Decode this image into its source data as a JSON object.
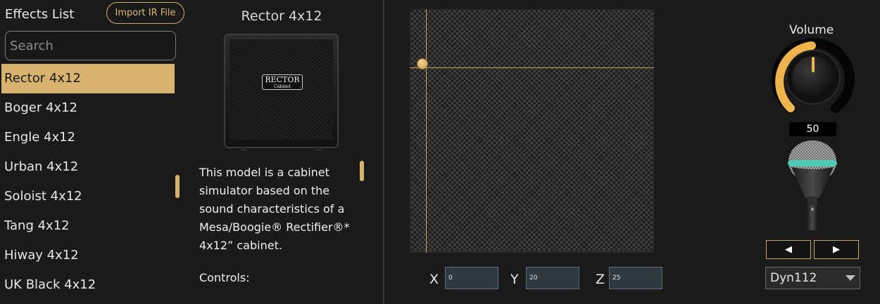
{
  "effects": {
    "title": "Effects List",
    "import_button": "Import IR File",
    "search_placeholder": "Search",
    "items": [
      {
        "label": "Rector 4x12",
        "selected": true
      },
      {
        "label": "Boger 4x12",
        "selected": false
      },
      {
        "label": "Engle 4x12",
        "selected": false
      },
      {
        "label": "Urban 4x12",
        "selected": false
      },
      {
        "label": "Soloist 4x12",
        "selected": false
      },
      {
        "label": "Tang 4x12",
        "selected": false
      },
      {
        "label": "Hiway 4x12",
        "selected": false
      },
      {
        "label": "UK Black 4x12",
        "selected": false
      }
    ]
  },
  "model": {
    "title": "Rector 4x12",
    "badge_text": "RECTOR",
    "badge_sub": "Cabinet",
    "description": "This model is a cabinet simulator based on the sound characteristics of a Mesa/Boogie® Rectifier®* 4x12”   cabinet.",
    "controls_label": "Controls:"
  },
  "position": {
    "x_label": "X",
    "x_value": "0",
    "y_label": "Y",
    "y_value": "20",
    "z_label": "Z",
    "z_value": "25"
  },
  "volume": {
    "label": "Volume",
    "value": "50",
    "level": 0.5
  },
  "mic": {
    "prev_icon": "◀",
    "next_icon": "▶",
    "selected": "Dyn112"
  },
  "colors": {
    "accent": "#d8b36e",
    "background": "#1a1a1a",
    "mic_band": "#4fc9b6"
  }
}
